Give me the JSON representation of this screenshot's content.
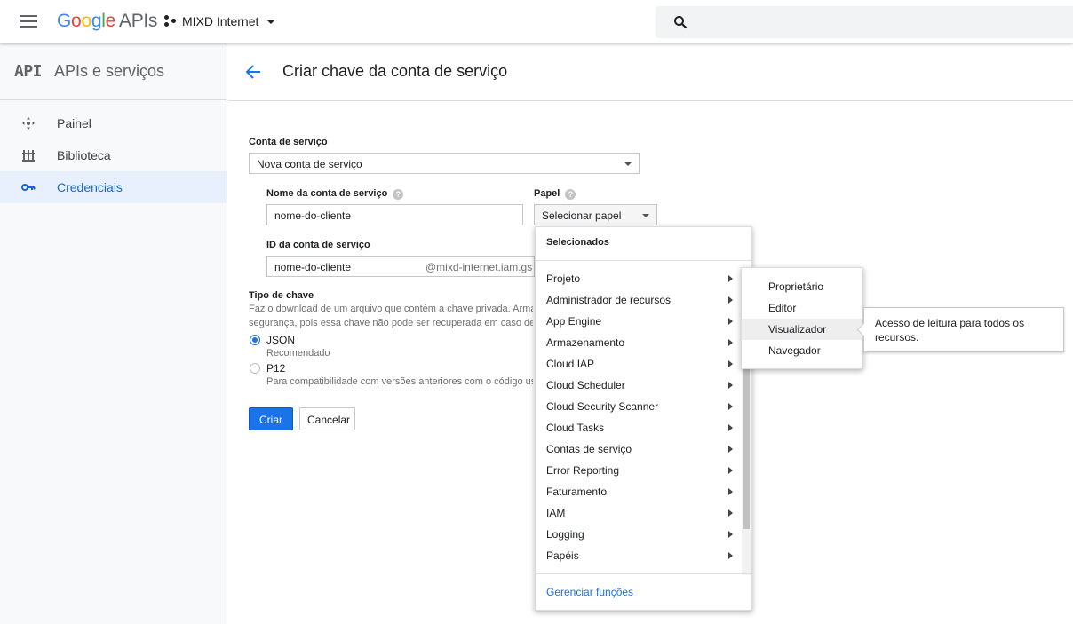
{
  "topbar": {
    "logo_parts": [
      "G",
      "o",
      "o",
      "g",
      "l",
      "e"
    ],
    "logo_suffix": "APIs",
    "project_name": "MIXD Internet",
    "search_placeholder": ""
  },
  "sidebar": {
    "brand_mark": "API",
    "title": "APIs e serviços",
    "items": [
      {
        "label": "Painel",
        "icon": "dashboard-icon"
      },
      {
        "label": "Biblioteca",
        "icon": "library-icon"
      },
      {
        "label": "Credenciais",
        "icon": "key-icon",
        "active": true
      }
    ]
  },
  "header": {
    "title": "Criar chave da conta de serviço"
  },
  "form": {
    "service_account_label": "Conta de serviço",
    "service_account_value": "Nova conta de serviço",
    "name_label": "Nome da conta de serviço",
    "name_value": "nome-do-cliente",
    "role_label": "Papel",
    "role_value": "Selecionar papel",
    "id_label": "ID da conta de serviço",
    "id_value": "nome-do-cliente",
    "id_suffix": "@mixd-internet.iam.gs",
    "key_type_label": "Tipo de chave",
    "key_type_desc_1": "Faz o download de um arquivo que contém a chave privada. Arma",
    "key_type_desc_2": "segurança, pois essa chave não pode ser recuperada em caso de",
    "json_label": "JSON",
    "json_sub": "Recomendado",
    "p12_label": "P12",
    "p12_sub": "Para compatibilidade com versões anteriores com o código us",
    "create_button": "Criar",
    "cancel_button": "Cancelar"
  },
  "role_menu": {
    "header": "Selecionados",
    "items": [
      "Projeto",
      "Administrador de recursos",
      "App Engine",
      "Armazenamento",
      "Cloud IAP",
      "Cloud Scheduler",
      "Cloud Security Scanner",
      "Cloud Tasks",
      "Contas de serviço",
      "Error Reporting",
      "Faturamento",
      "IAM",
      "Logging",
      "Papéis"
    ],
    "footer_link": "Gerenciar funções"
  },
  "project_submenu": {
    "items": [
      "Proprietário",
      "Editor",
      "Visualizador",
      "Navegador"
    ],
    "hovered": "Visualizador"
  },
  "tooltip": {
    "text": "Acesso de leitura para todos os recursos."
  },
  "colors": {
    "accent": "#1a73e8",
    "active_bg": "#e8f0fe",
    "google_blue": "#4285f4",
    "google_red": "#ea4335",
    "google_yellow": "#fbbc05",
    "google_green": "#34a853"
  }
}
